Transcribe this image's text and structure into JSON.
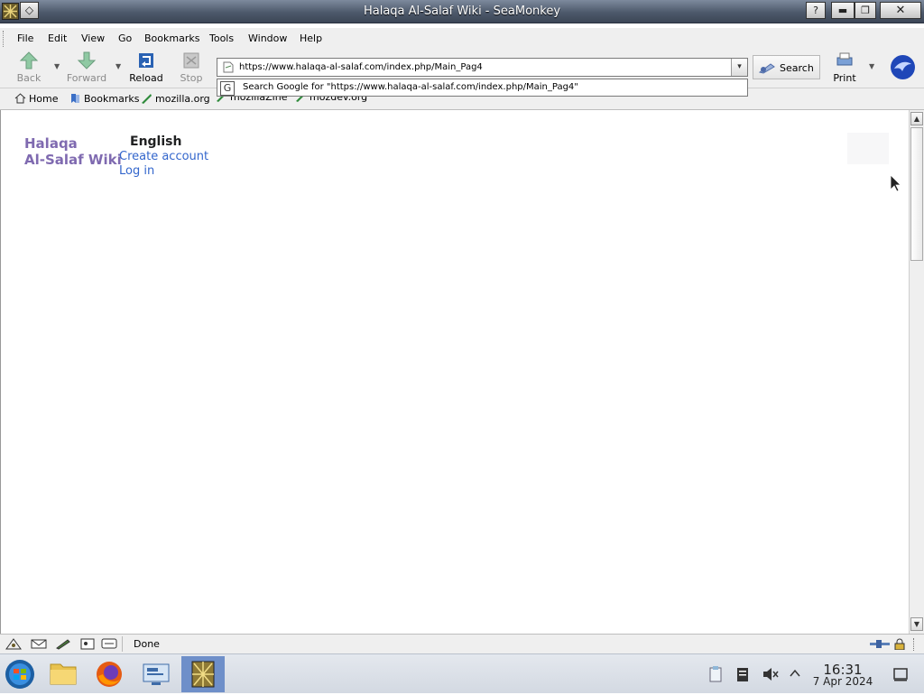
{
  "app": {
    "window_title": "Halaqa Al-Salaf Wiki - SeaMonkey",
    "menu": [
      "File",
      "Edit",
      "View",
      "Go",
      "Bookmarks",
      "Tools",
      "Window",
      "Help"
    ],
    "nav": {
      "back": "Back",
      "forward": "Forward",
      "reload": "Reload",
      "stop": "Stop",
      "search": "Search",
      "print": "Print"
    },
    "url": "https://www.halaqa-al-salaf.com/index.php/Main_Pag4",
    "url_suggestion": "Search Google for \"https://www.halaqa-al-salaf.com/index.php/Main_Pag4\"",
    "personal_toolbar": [
      "Home",
      "Bookmarks",
      "mozilla.org",
      "mozillaZine",
      "mozdev.org"
    ],
    "status": "Done"
  },
  "page": {
    "site_name_line1": "Halaqa",
    "site_name_line2": "Al-Salaf Wiki",
    "language": "English",
    "create_account": "Create account",
    "log_in": "Log in"
  },
  "taskbar": {
    "time": "16:31",
    "date": "7 Apr 2024"
  },
  "colors": {
    "site_logo": "#7f6ab0",
    "link": "#3366cc",
    "titlebar": "#4d596b",
    "taskbar_active": "#6e8fc9"
  },
  "icons": [
    "app-icon",
    "window-menu-icon",
    "help-icon",
    "minimize-icon",
    "maximize-icon",
    "close-icon",
    "back-icon",
    "forward-icon",
    "reload-icon",
    "stop-icon",
    "page-icon",
    "search-icon",
    "print-icon",
    "seamonkey-logo-icon",
    "home-icon",
    "bookmarks-icon",
    "mozilla-icon",
    "start-button-icon",
    "file-manager-icon",
    "firefox-icon",
    "remote-desktop-icon",
    "seamonkey-task-icon",
    "volume-muted-icon"
  ]
}
